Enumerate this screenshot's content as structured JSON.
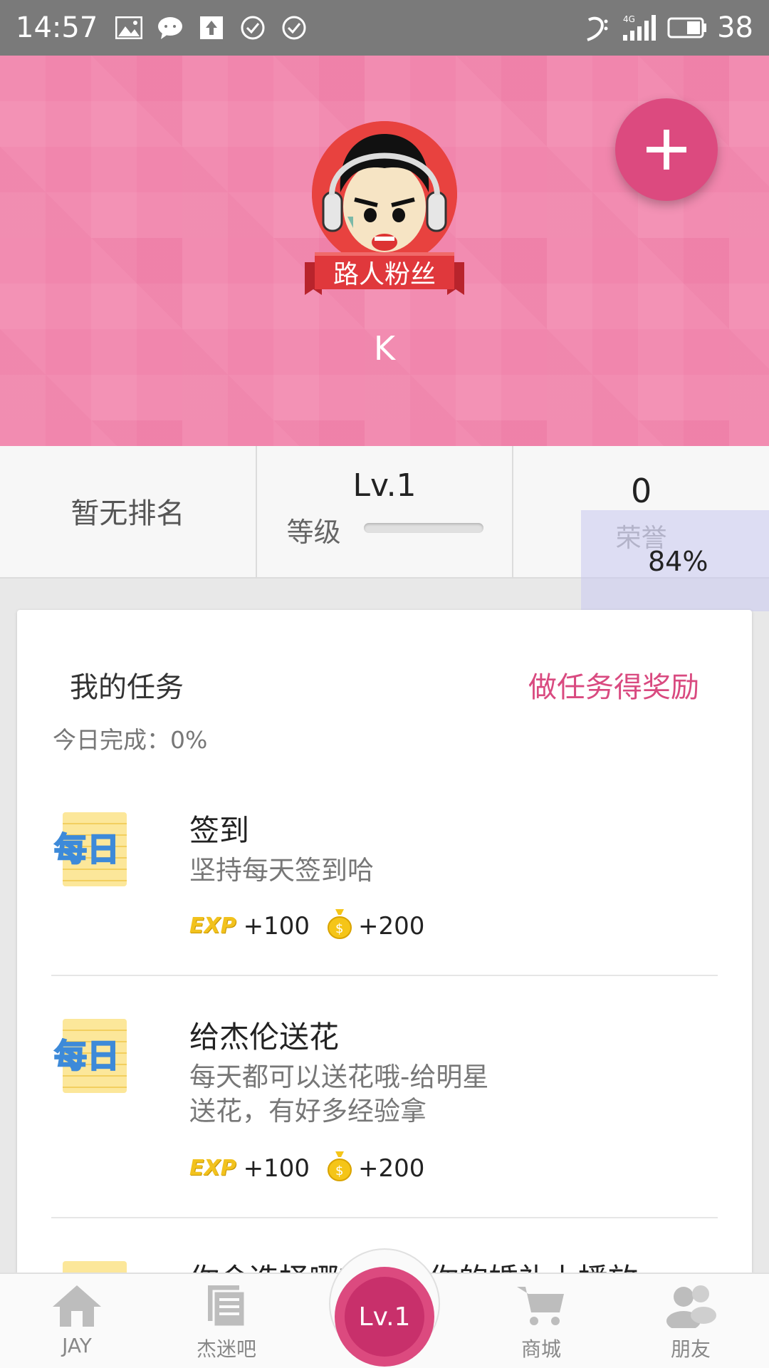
{
  "status_bar": {
    "time": "14:57",
    "battery": "38",
    "network": "4G"
  },
  "header": {
    "badge": "路人粉丝",
    "username": "K",
    "colors": {
      "header_bg": "#f186ad",
      "fab": "#dc4a7f"
    }
  },
  "stats": {
    "rank": "暂无排名",
    "level": "Lv.1",
    "level_label": "等级",
    "level_progress": 0.0,
    "honor_value": "0",
    "honor_label": "荣誉",
    "overlay_percent": "84%"
  },
  "tasks": {
    "title": "我的任务",
    "link": "做任务得奖励",
    "today": "今日完成：0%",
    "items": [
      {
        "icon_text": "每日",
        "title": "签到",
        "desc": "坚持每天签到哈",
        "exp_label": "EXP",
        "exp": "+100",
        "coins": "+200"
      },
      {
        "icon_text": "每日",
        "title": "给杰伦送花",
        "desc_line1": "每天都可以送花哦-给明星",
        "desc_line2": "送花，有好多经验拿",
        "exp_label": "EXP",
        "exp": "+100",
        "coins": "+200"
      },
      {
        "title": "你会选择哪首歌在你的婚礼上播放"
      }
    ]
  },
  "bottom_nav": {
    "items": [
      {
        "label": "JAY",
        "icon": "home-icon"
      },
      {
        "label": "杰迷吧",
        "icon": "forum-icon"
      },
      {
        "label": "Lv.1",
        "icon": "level-badge"
      },
      {
        "label": "商城",
        "icon": "cart-icon"
      },
      {
        "label": "朋友",
        "icon": "friends-icon"
      }
    ]
  }
}
